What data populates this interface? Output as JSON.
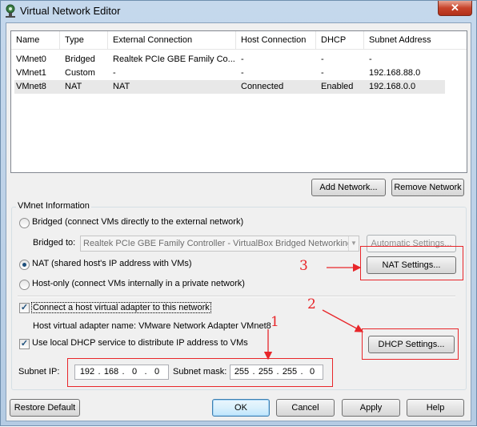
{
  "window": {
    "title": "Virtual Network Editor",
    "close_glyph": "✕"
  },
  "networks": {
    "columns": [
      "Name",
      "Type",
      "External Connection",
      "Host Connection",
      "DHCP",
      "Subnet Address"
    ],
    "rows": [
      {
        "name": "VMnet0",
        "type": "Bridged",
        "external": "Realtek PCIe GBE Family Co...",
        "host": "-",
        "dhcp": "-",
        "subnet": "-"
      },
      {
        "name": "VMnet1",
        "type": "Custom",
        "external": "-",
        "host": "-",
        "dhcp": "-",
        "subnet": "192.168.88.0"
      },
      {
        "name": "VMnet8",
        "type": "NAT",
        "external": "NAT",
        "host": "Connected",
        "dhcp": "Enabled",
        "subnet": "192.168.0.0"
      }
    ]
  },
  "buttons": {
    "add_network": "Add Network...",
    "remove_network": "Remove Network",
    "automatic_settings": "Automatic Settings...",
    "nat_settings": "NAT Settings...",
    "dhcp_settings": "DHCP Settings...",
    "restore_default": "Restore Default",
    "ok": "OK",
    "cancel": "Cancel",
    "apply": "Apply",
    "help": "Help"
  },
  "vmnet_info": {
    "group_label": "VMnet Information",
    "bridged_label": "Bridged (connect VMs directly to the external network)",
    "bridged_to_label": "Bridged to:",
    "bridged_to_value": "Realtek PCIe GBE Family Controller - VirtualBox Bridged Networking",
    "nat_label": "NAT (shared host's IP address with VMs)",
    "hostonly_label": "Host-only (connect VMs internally in a private network)",
    "selected_mode": "nat",
    "connect_adapter_label": "Connect a host virtual adapter to this network",
    "connect_adapter_checked": true,
    "adapter_name_label": "Host virtual adapter name: VMware Network Adapter VMnet8",
    "use_dhcp_label": "Use local DHCP service to distribute IP address to VMs",
    "use_dhcp_checked": true,
    "subnet_ip_label": "Subnet IP:",
    "subnet_ip": [
      "192",
      "168",
      "0",
      "0"
    ],
    "subnet_mask_label": "Subnet mask:",
    "subnet_mask": [
      "255",
      "255",
      "255",
      "0"
    ]
  },
  "annotations": {
    "one": "1",
    "two": "2",
    "three": "3",
    "color": "#e8262a"
  },
  "checkmark_glyph": "✓"
}
